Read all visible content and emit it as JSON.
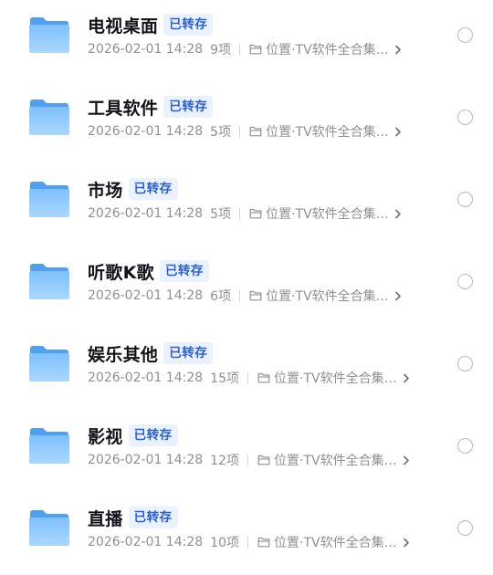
{
  "badge_label": "已转存",
  "location": {
    "label": "位置·TV软件全合集…",
    "icon": "folder-outline-icon"
  },
  "row_icon": "folder-icon",
  "action_icon": "chevron-right-icon",
  "colors": {
    "folder_light": "#a6d6ff",
    "folder_dark": "#4f9ff2",
    "badge_bg": "#eaf1ff",
    "badge_text": "#2a5fd6"
  },
  "files": [
    {
      "name": "电视桌面",
      "datetime": "2026-02-01 14:28",
      "count": "9项"
    },
    {
      "name": "工具软件",
      "datetime": "2026-02-01 14:28",
      "count": "5项"
    },
    {
      "name": "市场",
      "datetime": "2026-02-01 14:28",
      "count": "5项"
    },
    {
      "name": "听歌K歌",
      "datetime": "2026-02-01 14:28",
      "count": "6项"
    },
    {
      "name": "娱乐其他",
      "datetime": "2026-02-01 14:28",
      "count": "15项"
    },
    {
      "name": "影视",
      "datetime": "2026-02-01 14:28",
      "count": "12项"
    },
    {
      "name": "直播",
      "datetime": "2026-02-01 14:28",
      "count": "10项"
    }
  ]
}
